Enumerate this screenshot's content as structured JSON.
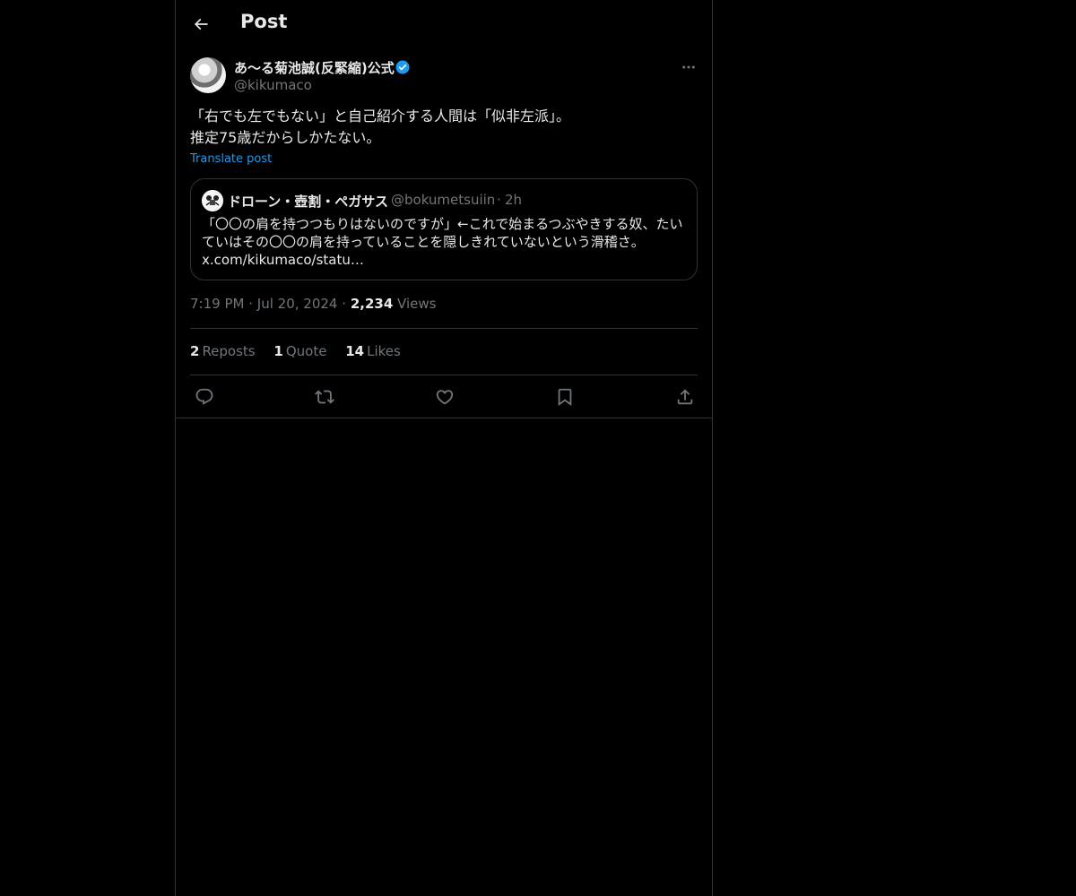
{
  "header": {
    "title": "Post"
  },
  "post": {
    "author_name": "あ～る菊池誠(反緊縮)公式",
    "author_handle": "@kikumaco",
    "text_line1": "「右でも左でもない」と自己紹介する人間は「似非左派」。",
    "text_line2": "推定75歳だからしかたない。",
    "translate_label": "Translate post",
    "quote": {
      "name": "ドローン・壺割・ペガサス",
      "handle": "@bokumetsuiin",
      "separator": "·",
      "time": "2h",
      "text": "「〇〇の肩を持つつもりはないのですが」←これで始まるつぶやきする奴、たいていはその〇〇の肩を持っていることを隠しきれていないという滑稽さ。",
      "link": "x.com/kikumaco/statu…"
    },
    "time": "7:19 PM",
    "date": "Jul 20, 2024",
    "dot": "·",
    "views_count": "2,234",
    "views_label": "Views",
    "stats": {
      "reposts_count": "2",
      "reposts_label": "Reposts",
      "quotes_count": "1",
      "quotes_label": "Quote",
      "likes_count": "14",
      "likes_label": "Likes"
    }
  },
  "colors": {
    "accent": "#1d9bf0",
    "muted": "#71767b",
    "border": "#2f3336",
    "background": "#000000"
  },
  "icons": [
    "back-arrow-icon",
    "verified-badge-icon",
    "more-icon",
    "reply-icon",
    "repost-icon",
    "like-icon",
    "bookmark-icon",
    "share-icon"
  ]
}
